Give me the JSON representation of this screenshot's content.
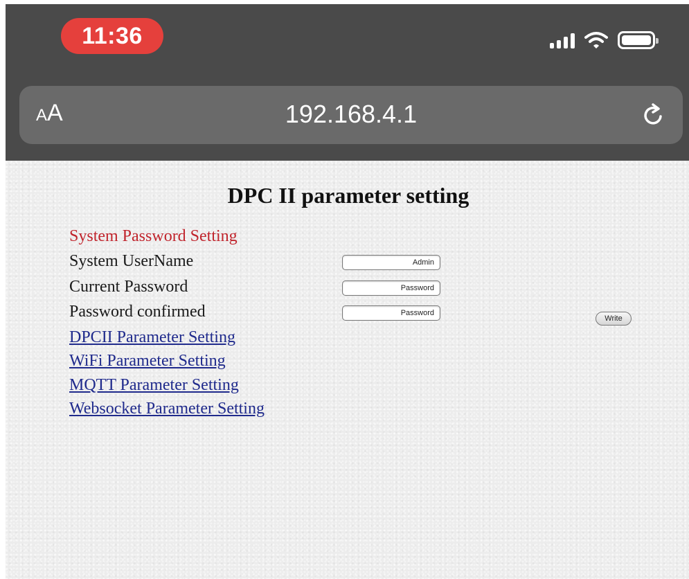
{
  "status_bar": {
    "time": "11:36",
    "icons": [
      "cellular-signal-icon",
      "wifi-icon",
      "battery-icon"
    ],
    "time_color": "#e5403c"
  },
  "browser": {
    "text_size_button": {
      "small": "A",
      "large": "A"
    },
    "url": "192.168.4.1",
    "reload_icon": "reload-icon"
  },
  "page": {
    "title": "DPC II parameter setting",
    "section_heading": "System Password Setting",
    "fields": [
      {
        "label": "System UserName",
        "value": "Admin"
      },
      {
        "label": "Current Password",
        "value": "Password"
      },
      {
        "label": "Password confirmed",
        "value": "Password"
      }
    ],
    "write_button": "Write",
    "links": [
      "DPCII Parameter Setting",
      "WiFi Parameter Setting",
      "MQTT Parameter Setting",
      "Websocket Parameter Setting"
    ],
    "colors": {
      "section_heading": "#c0242c",
      "link": "#1f2a8c",
      "chrome_background": "#4a4a4a"
    }
  }
}
